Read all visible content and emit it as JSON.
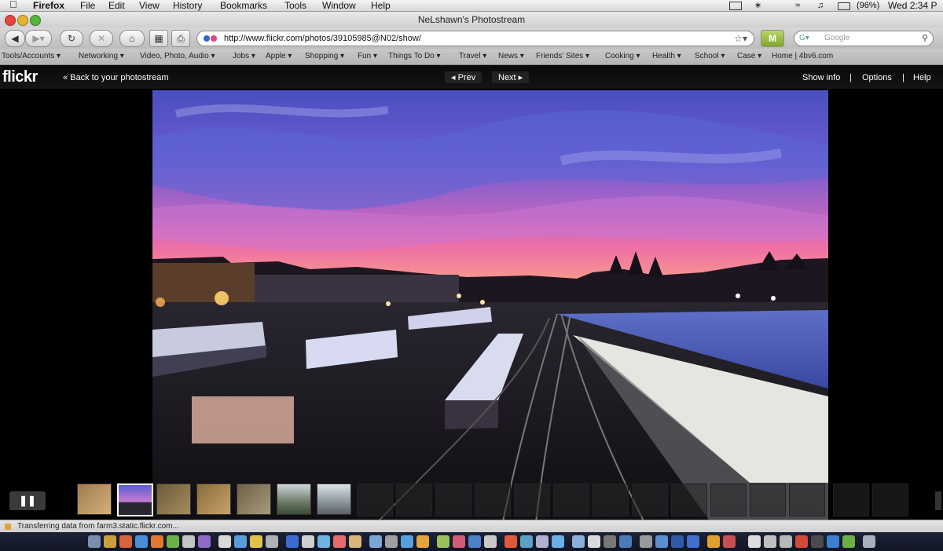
{
  "menubar": {
    "app_name": "Firefox",
    "items": [
      "File",
      "Edit",
      "View",
      "History",
      "Bookmarks",
      "Tools",
      "Window",
      "Help"
    ],
    "battery": "(96%)",
    "clock": "Wed 2:34 P"
  },
  "window": {
    "title": "NeLshawn's Photostream"
  },
  "toolbar": {
    "url": "http://www.flickr.com/photos/39105985@N02/show/",
    "search_placeholder": "Google"
  },
  "bookmarks": [
    "Tools/Accounts ▾",
    "Networking ▾",
    "Video, Photo, Audio ▾",
    "Jobs ▾",
    "Apple ▾",
    "Shopping ▾",
    "Fun ▾",
    "Things To Do ▾",
    "Travel ▾",
    "News ▾",
    "Friends' Sites ▾",
    "Cooking ▾",
    "Health ▾",
    "School ▾",
    "Case ▾",
    "Home | 4bv6.com"
  ],
  "flickr": {
    "logo": "flickr",
    "back_link": "« Back to your photostream",
    "prev": "◂ Prev",
    "next": "Next ▸",
    "show_info": "Show info",
    "options": "Options",
    "help": "Help",
    "separator": "|"
  },
  "status": {
    "text": "Transferring data from farm3.static.flickr.com..."
  },
  "colors": {
    "accent_blue": "#3c6bd1",
    "sky_purple": "#6a5bd0",
    "sky_pink": "#ef6fa6"
  }
}
